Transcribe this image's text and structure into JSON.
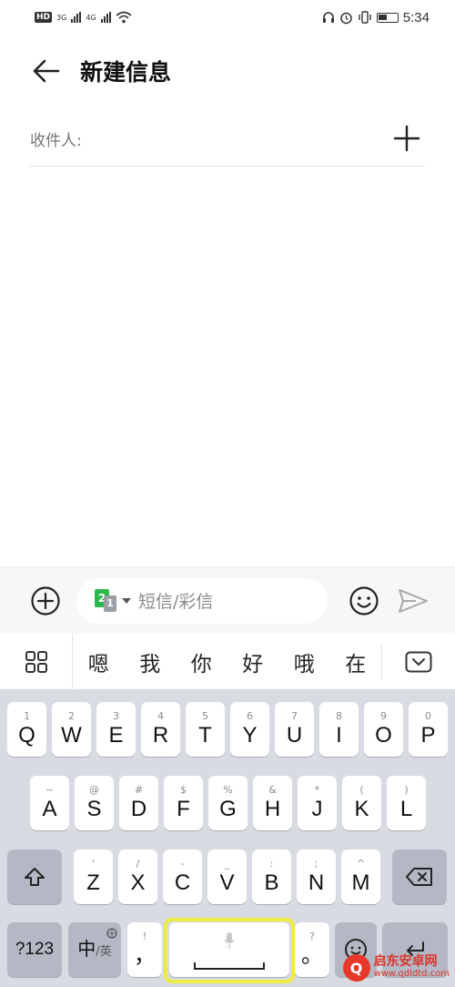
{
  "status_bar": {
    "hd": "HD",
    "sim1": "3G",
    "sim2": "4G",
    "time": "5:34"
  },
  "header": {
    "title": "新建信息"
  },
  "recipient": {
    "label": "收件人:"
  },
  "compose": {
    "sim_slot_primary": "2",
    "sim_slot_secondary": "1",
    "placeholder": "短信/彩信"
  },
  "candidates": [
    "嗯",
    "我",
    "你",
    "好",
    "哦",
    "在"
  ],
  "keyboard": {
    "row1": [
      {
        "main": "Q",
        "sub": "1"
      },
      {
        "main": "W",
        "sub": "2"
      },
      {
        "main": "E",
        "sub": "3"
      },
      {
        "main": "R",
        "sub": "4"
      },
      {
        "main": "T",
        "sub": "5"
      },
      {
        "main": "Y",
        "sub": "6"
      },
      {
        "main": "U",
        "sub": "7"
      },
      {
        "main": "I",
        "sub": "8"
      },
      {
        "main": "O",
        "sub": "9"
      },
      {
        "main": "P",
        "sub": "0"
      }
    ],
    "row2": [
      {
        "main": "A",
        "sub": "~"
      },
      {
        "main": "S",
        "sub": "@"
      },
      {
        "main": "D",
        "sub": "#"
      },
      {
        "main": "F",
        "sub": "$"
      },
      {
        "main": "G",
        "sub": "%"
      },
      {
        "main": "H",
        "sub": "&"
      },
      {
        "main": "J",
        "sub": "*"
      },
      {
        "main": "K",
        "sub": "("
      },
      {
        "main": "L",
        "sub": ")"
      }
    ],
    "row3": [
      {
        "main": "Z",
        "sub": "'"
      },
      {
        "main": "X",
        "sub": "/"
      },
      {
        "main": "C",
        "sub": "-"
      },
      {
        "main": "V",
        "sub": "_"
      },
      {
        "main": "B",
        "sub": ":"
      },
      {
        "main": "N",
        "sub": ";"
      },
      {
        "main": "M",
        "sub": "^"
      }
    ],
    "num_key": "?123",
    "lang_key_main": "中",
    "lang_key_sub": "/英",
    "comma_key": {
      "main": "，",
      "sub": "!"
    },
    "period_key": {
      "main": "。",
      "sub": "?"
    }
  },
  "colors": {
    "highlight": "#ecec43",
    "keyboard_bg": "#d9dbe2",
    "sim_green": "#2db84d"
  },
  "watermark": {
    "name": "启东安卓网",
    "url": "www.qdldtd.com"
  }
}
